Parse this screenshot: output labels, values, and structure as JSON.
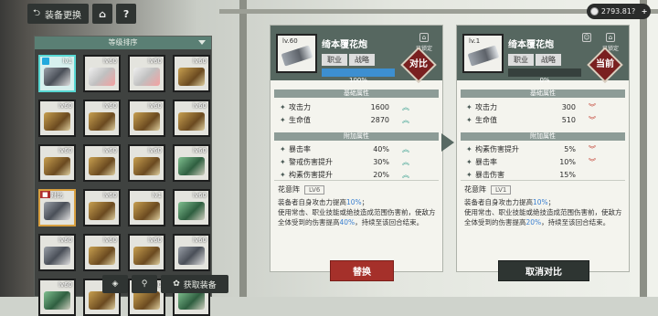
{
  "header": {
    "back_label": "装备更换",
    "home_icon": "home-icon",
    "help_label": "?"
  },
  "currency": {
    "value": "2793.81?",
    "plus": "+"
  },
  "list": {
    "sort_label": "等级排序",
    "cards": [
      {
        "lv": "lv1",
        "art": "d",
        "state": "sel"
      },
      {
        "lv": "lv60",
        "art": "b"
      },
      {
        "lv": "lv60",
        "art": "b"
      },
      {
        "lv": "lv60",
        "art": "a"
      },
      {
        "lv": "lv60",
        "art": "a"
      },
      {
        "lv": "lv60",
        "art": "a"
      },
      {
        "lv": "lv60",
        "art": "a"
      },
      {
        "lv": "lv60",
        "art": "a"
      },
      {
        "lv": "lv60",
        "art": "a"
      },
      {
        "lv": "lv60",
        "art": "a"
      },
      {
        "lv": "lv60",
        "art": "a"
      },
      {
        "lv": "lv60",
        "art": "c"
      },
      {
        "lv": "对比",
        "art": "d",
        "state": "cmp",
        "badge": "■"
      },
      {
        "lv": "lv60",
        "art": "a"
      },
      {
        "lv": "lv1",
        "art": "a"
      },
      {
        "lv": "lv60",
        "art": "c"
      },
      {
        "lv": "lv60",
        "art": "d"
      },
      {
        "lv": "lv60",
        "art": "a"
      },
      {
        "lv": "lv60",
        "art": "a"
      },
      {
        "lv": "lv60",
        "art": "d"
      },
      {
        "lv": "lv60",
        "art": "c"
      },
      {
        "lv": "lv60",
        "art": "a"
      },
      {
        "lv": "lv60",
        "art": "a"
      },
      {
        "lv": "lv60",
        "art": "c"
      }
    ]
  },
  "toolbar": {
    "filter_icon": "filter-icon",
    "sort_icon": "sort-icon",
    "obtain_label": "获取装备"
  },
  "compare": {
    "lv": "lv.60",
    "name": "绮本覆花炮",
    "job_label": "职业",
    "job_value": "战略",
    "progress": "100%",
    "progress_fill": 1.0,
    "lock_label": "已锁定",
    "stamp": "对比",
    "base_title": "基础属性",
    "base": [
      {
        "label": "攻击力",
        "value": "1600",
        "dir": "up"
      },
      {
        "label": "生命值",
        "value": "2870",
        "dir": "up"
      }
    ],
    "extra_title": "附加属性",
    "extra": [
      {
        "label": "暴击率",
        "value": "40%",
        "dir": "up"
      },
      {
        "label": "警戒伤害提升",
        "value": "30%",
        "dir": "up"
      },
      {
        "label": "构素伤害提升",
        "value": "20%",
        "dir": "up"
      }
    ],
    "skill_name": "花意阵",
    "skill_lv": "LV6",
    "desc1_a": "装备者自身攻击力提高",
    "desc1_b": "10%",
    "desc1_c": "；",
    "desc2_a": "使用常击、职业技能或绝技造成范围伤害前，使敌方全体受到的伤害提高",
    "desc2_b": "40%",
    "desc2_c": "，持续至该回合结束。",
    "action": "替换"
  },
  "current": {
    "lv": "lv.1",
    "name": "绮本覆花炮",
    "job_label": "职业",
    "job_value": "战略",
    "progress": "0%",
    "progress_fill": 0.0,
    "lock_label": "已锁定",
    "stamp": "当前",
    "base_title": "基础属性",
    "base": [
      {
        "label": "攻击力",
        "value": "300",
        "dir": "down"
      },
      {
        "label": "生命值",
        "value": "510",
        "dir": "down"
      }
    ],
    "extra_title": "附加属性",
    "extra": [
      {
        "label": "构素伤害提升",
        "value": "5%",
        "dir": "down"
      },
      {
        "label": "暴击率",
        "value": "10%",
        "dir": "down"
      },
      {
        "label": "暴击伤害",
        "value": "15%",
        "dir": ""
      }
    ],
    "skill_name": "花意阵",
    "skill_lv": "LV1",
    "desc1_a": "装备者自身攻击力提高",
    "desc1_b": "10%",
    "desc1_c": "；",
    "desc2_a": "使用常击、职业技能或绝技造成范围伤害前，使敌方全体受到的伤害提高",
    "desc2_b": "20%",
    "desc2_c": "，持续至该回合结束。",
    "action": "取消对比"
  }
}
